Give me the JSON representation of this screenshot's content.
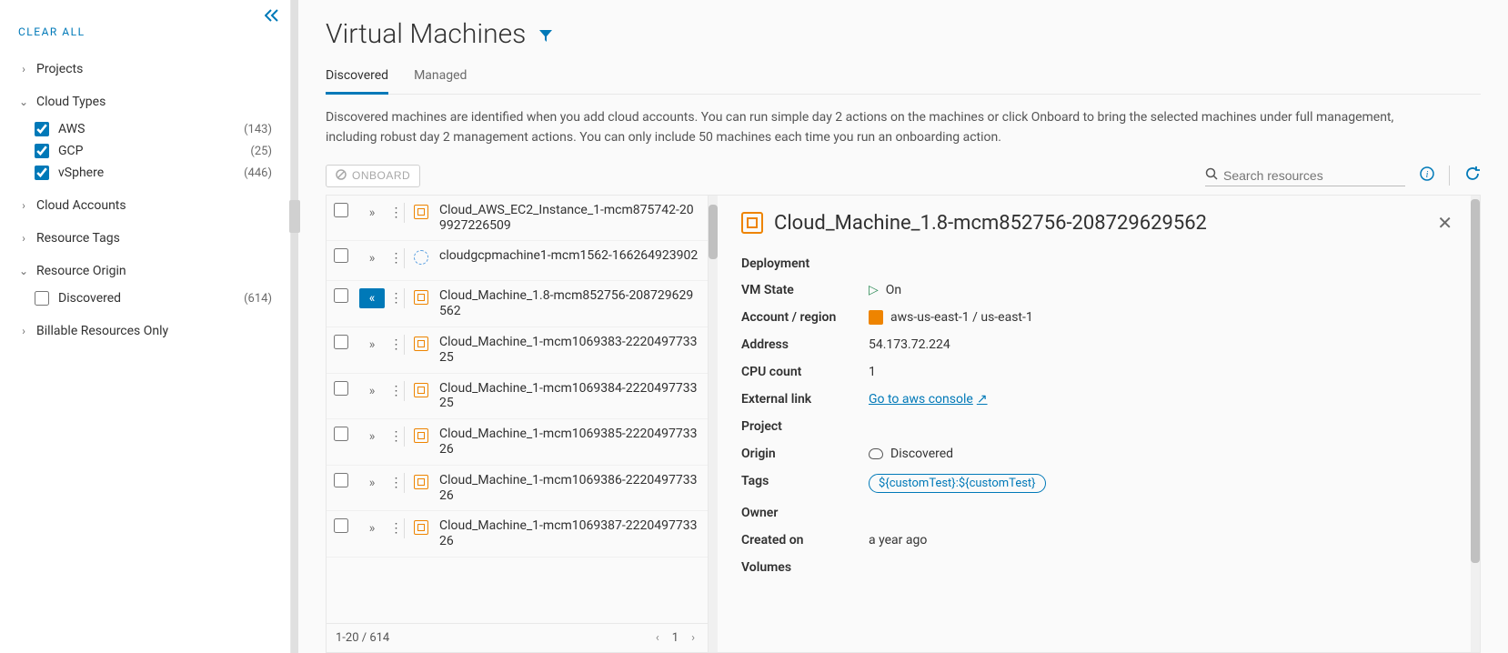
{
  "sidebar": {
    "clear_all": "CLEAR ALL",
    "groups": [
      {
        "label": "Projects",
        "expanded": false,
        "items": []
      },
      {
        "label": "Cloud Types",
        "expanded": true,
        "items": [
          {
            "label": "AWS",
            "checked": true,
            "count": "(143)"
          },
          {
            "label": "GCP",
            "checked": true,
            "count": "(25)"
          },
          {
            "label": "vSphere",
            "checked": true,
            "count": "(446)"
          }
        ]
      },
      {
        "label": "Cloud Accounts",
        "expanded": false,
        "items": []
      },
      {
        "label": "Resource Tags",
        "expanded": false,
        "items": []
      },
      {
        "label": "Resource Origin",
        "expanded": true,
        "items": [
          {
            "label": "Discovered",
            "checked": false,
            "count": "(614)"
          }
        ]
      },
      {
        "label": "Billable Resources Only",
        "expanded": false,
        "items": []
      }
    ]
  },
  "header": {
    "title": "Virtual Machines",
    "tabs": [
      {
        "label": "Discovered",
        "active": true
      },
      {
        "label": "Managed",
        "active": false
      }
    ],
    "description": "Discovered machines are identified when you add cloud accounts. You can run simple day 2 actions on the machines or click Onboard to bring the selected machines under full management, including robust day 2 management actions. You can only include 50 machines each time you run an onboarding action."
  },
  "toolbar": {
    "onboard": "ONBOARD",
    "search_placeholder": "Search resources"
  },
  "table": {
    "rows": [
      {
        "icon": "aws",
        "label": "Cloud_AWS_EC2_Instance_1-mcm875742-209927226509"
      },
      {
        "icon": "gcp",
        "label": "cloudgcpmachine1-mcm1562-166264923902"
      },
      {
        "icon": "aws",
        "label": "Cloud_Machine_1.8-mcm852756-208729629562",
        "selected": true
      },
      {
        "icon": "aws",
        "label": "Cloud_Machine_1-mcm1069383-222049773325"
      },
      {
        "icon": "aws",
        "label": "Cloud_Machine_1-mcm1069384-222049773325"
      },
      {
        "icon": "aws",
        "label": "Cloud_Machine_1-mcm1069385-222049773326"
      },
      {
        "icon": "aws",
        "label": "Cloud_Machine_1-mcm1069386-222049773326"
      },
      {
        "icon": "aws",
        "label": "Cloud_Machine_1-mcm1069387-222049773326"
      }
    ],
    "pager_left": "1-20 / 614",
    "pager_page": "1"
  },
  "detail": {
    "title": "Cloud_Machine_1.8-mcm852756-208729629562",
    "deployment_label": "Deployment",
    "fields": {
      "vm_state_k": "VM State",
      "vm_state_v": "On",
      "account_k": "Account / region",
      "account_v": "aws-us-east-1 / us-east-1",
      "address_k": "Address",
      "address_v": "54.173.72.224",
      "cpu_k": "CPU count",
      "cpu_v": "1",
      "ext_k": "External link",
      "ext_v": "Go to aws console",
      "project_k": "Project",
      "origin_k": "Origin",
      "origin_v": "Discovered",
      "tags_k": "Tags",
      "tags_v": "${customTest}:${customTest}",
      "owner_k": "Owner",
      "created_k": "Created on",
      "created_v": "a year ago",
      "volumes_k": "Volumes"
    }
  }
}
